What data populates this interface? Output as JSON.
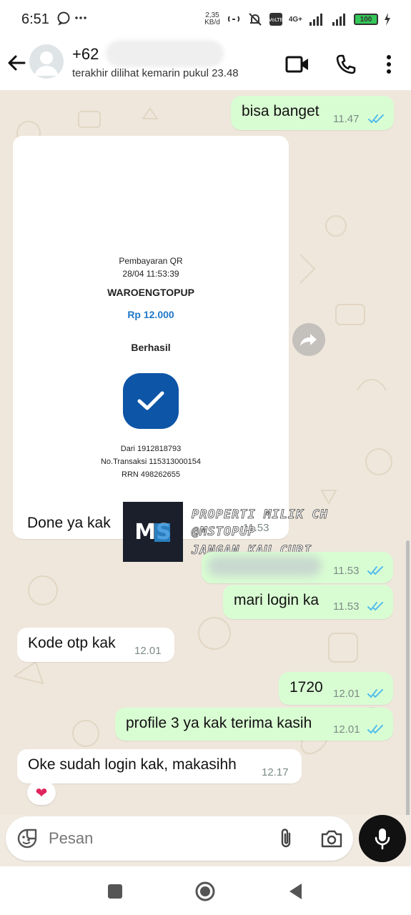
{
  "status_bar": {
    "time": "6:51",
    "speed_value": "2,35",
    "speed_unit": "KB/d",
    "network": "4G+",
    "battery": "100"
  },
  "header": {
    "contact_prefix": "+62",
    "last_seen": "terakhir dilihat kemarin pukul 23.48"
  },
  "messages": [
    {
      "text": "bisa banget",
      "time": "11.47",
      "dir": "out"
    },
    {
      "text": "Done ya kak",
      "time": "11.53",
      "dir": "in"
    },
    {
      "text": "",
      "time": "11.53",
      "dir": "out"
    },
    {
      "text": "mari login ka",
      "time": "11.53",
      "dir": "out"
    },
    {
      "text": "Kode otp kak",
      "time": "12.01",
      "dir": "in"
    },
    {
      "text": "1720",
      "time": "12.01",
      "dir": "out"
    },
    {
      "text": "profile 3 ya kak terima kasih",
      "time": "12.01",
      "dir": "out"
    },
    {
      "text": "Oke sudah login kak, makasihh",
      "time": "12.17",
      "dir": "in"
    }
  ],
  "receipt": {
    "type": "Pembayaran QR",
    "datetime": "28/04 11:53:39",
    "merchant": "WAROENGTOPUP",
    "amount": "Rp 12.000",
    "status": "Berhasil",
    "from": "Dari 1912818793",
    "transaction": "No.Transaksi 115313000154",
    "rrn": "RRN 498262655"
  },
  "watermark": {
    "line1": "PROPERTI MILIK CH",
    "line2": "@MSTOPUP",
    "line3": "JANGAN KAU CURI",
    "logo_text": "MS"
  },
  "reaction_emoji": "❤",
  "input": {
    "placeholder": "Pesan"
  },
  "colors": {
    "outgoing_bubble": "#d9fdd3",
    "incoming_bubble": "#ffffff",
    "read_ticks": "#53bdeb",
    "amount_blue": "#1f78c8",
    "check_badge": "#0d55a6"
  }
}
